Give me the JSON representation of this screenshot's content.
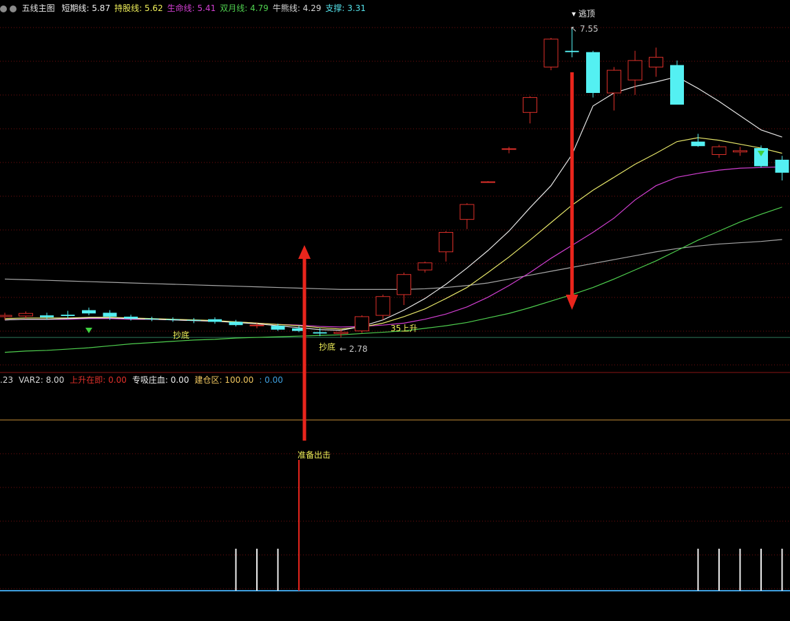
{
  "colors": {
    "background": "#000000",
    "bull": "#e0302a",
    "bear": "#54f0f2",
    "white": "#e8e8e8",
    "yellow": "#e8e86a",
    "magenta": "#d23fd2",
    "green": "#4fd14f",
    "grey": "#a8a8a8",
    "grid": "#7a1010",
    "arrow": "#e8251c",
    "orange": "#c89036",
    "blue": "#3fa0e0"
  },
  "top_legend": {
    "title": "五线主图",
    "items": [
      {
        "label": "短期线: ",
        "value": "5.87",
        "color": "#f0f0f0"
      },
      {
        "label": "持股线: ",
        "value": "5.62",
        "color": "#f2f25a"
      },
      {
        "label": "生命线: ",
        "value": "5.41",
        "color": "#d23fd2"
      },
      {
        "label": "双月线: ",
        "value": "4.79",
        "color": "#4fd14f"
      },
      {
        "label": "牛熊线: ",
        "value": "4.29",
        "color": "#d8d8d8"
      },
      {
        "label": "支撑: ",
        "value": "3.31",
        "color": "#54e2ea"
      }
    ]
  },
  "bottom_legend": {
    "items": [
      {
        "text": ".23",
        "color": "#d8d8d8"
      },
      {
        "text": "VAR2: 8.00",
        "color": "#d8d8d8"
      },
      {
        "text": "上升在即: 0.00",
        "color": "#e0302a"
      },
      {
        "text": "专吸庄血: 0.00",
        "color": "#f0f0f0"
      },
      {
        "text": "建仓区: 100.00",
        "color": "#f2c860"
      },
      {
        "text": ": 0.00",
        "color": "#3fa0e0"
      }
    ]
  },
  "annotations": {
    "chaodi1": "抄底",
    "chaodi2": "抄底",
    "low": "2.78",
    "high": "7.55",
    "rise": "35上升",
    "top_signal": "逃顶",
    "prepare": "准备出击"
  },
  "chart_data": {
    "type": "candlestick",
    "candles": [
      {
        "o": 3.1,
        "h": 3.16,
        "l": 3.05,
        "c": 3.12
      },
      {
        "o": 3.11,
        "h": 3.18,
        "l": 3.07,
        "c": 3.15
      },
      {
        "o": 3.12,
        "h": 3.16,
        "l": 3.05,
        "c": 3.09
      },
      {
        "o": 3.13,
        "h": 3.19,
        "l": 3.07,
        "c": 3.11
      },
      {
        "o": 3.2,
        "h": 3.24,
        "l": 3.12,
        "c": 3.15
      },
      {
        "o": 3.16,
        "h": 3.2,
        "l": 3.05,
        "c": 3.1
      },
      {
        "o": 3.1,
        "h": 3.13,
        "l": 3.04,
        "c": 3.07
      },
      {
        "o": 3.07,
        "h": 3.1,
        "l": 3.03,
        "c": 3.06
      },
      {
        "o": 3.06,
        "h": 3.09,
        "l": 3.02,
        "c": 3.05
      },
      {
        "o": 3.05,
        "h": 3.08,
        "l": 3.0,
        "c": 3.04
      },
      {
        "o": 3.06,
        "h": 3.09,
        "l": 2.99,
        "c": 3.02
      },
      {
        "o": 3.02,
        "h": 3.05,
        "l": 2.95,
        "c": 2.97
      },
      {
        "o": 2.96,
        "h": 3.0,
        "l": 2.92,
        "c": 2.97
      },
      {
        "o": 2.96,
        "h": 2.99,
        "l": 2.88,
        "c": 2.9
      },
      {
        "o": 2.92,
        "h": 2.96,
        "l": 2.86,
        "c": 2.88
      },
      {
        "o": 2.86,
        "h": 2.92,
        "l": 2.8,
        "c": 2.84
      },
      {
        "o": 2.84,
        "h": 2.9,
        "l": 2.78,
        "c": 2.86
      },
      {
        "o": 2.88,
        "h": 3.12,
        "l": 2.85,
        "c": 3.1
      },
      {
        "o": 3.12,
        "h": 3.44,
        "l": 3.05,
        "c": 3.41
      },
      {
        "o": 3.44,
        "h": 3.78,
        "l": 3.28,
        "c": 3.75
      },
      {
        "o": 3.82,
        "h": 3.95,
        "l": 3.78,
        "c": 3.93
      },
      {
        "o": 4.1,
        "h": 4.42,
        "l": 3.95,
        "c": 4.4
      },
      {
        "o": 4.6,
        "h": 4.85,
        "l": 4.45,
        "c": 4.83
      },
      {
        "o": 5.18,
        "h": 5.19,
        "l": 5.17,
        "c": 5.18
      },
      {
        "o": 5.69,
        "h": 5.72,
        "l": 5.62,
        "c": 5.69
      },
      {
        "o": 6.25,
        "h": 6.5,
        "l": 6.08,
        "c": 6.48
      },
      {
        "o": 6.95,
        "h": 7.4,
        "l": 6.9,
        "c": 7.38
      },
      {
        "o": 7.2,
        "h": 7.55,
        "l": 7.1,
        "c": 7.18
      },
      {
        "o": 7.18,
        "h": 7.2,
        "l": 6.48,
        "c": 6.55
      },
      {
        "o": 6.55,
        "h": 6.95,
        "l": 6.28,
        "c": 6.9
      },
      {
        "o": 6.75,
        "h": 7.2,
        "l": 6.52,
        "c": 7.05
      },
      {
        "o": 6.95,
        "h": 7.25,
        "l": 6.8,
        "c": 7.1
      },
      {
        "o": 6.98,
        "h": 7.05,
        "l": 6.45,
        "c": 6.37
      },
      {
        "o": 5.8,
        "h": 5.92,
        "l": 5.72,
        "c": 5.73
      },
      {
        "o": 5.6,
        "h": 5.75,
        "l": 5.55,
        "c": 5.72
      },
      {
        "o": 5.64,
        "h": 5.72,
        "l": 5.58,
        "c": 5.66
      },
      {
        "o": 5.7,
        "h": 5.74,
        "l": 5.4,
        "c": 5.42
      },
      {
        "o": 5.52,
        "h": 5.58,
        "l": 5.2,
        "c": 5.32
      }
    ],
    "ma_short": [
      3.05,
      3.06,
      3.06,
      3.07,
      3.08,
      3.08,
      3.07,
      3.06,
      3.05,
      3.04,
      3.03,
      3.01,
      2.99,
      2.96,
      2.93,
      2.9,
      2.89,
      2.95,
      3.05,
      3.2,
      3.38,
      3.6,
      3.85,
      4.12,
      4.42,
      4.78,
      5.12,
      5.6,
      6.35,
      6.55,
      6.65,
      6.72,
      6.8,
      6.62,
      6.42,
      6.2,
      5.98,
      5.87
    ],
    "ma_hold": [
      3.07,
      3.08,
      3.08,
      3.08,
      3.09,
      3.09,
      3.08,
      3.07,
      3.06,
      3.05,
      3.04,
      3.02,
      3.0,
      2.98,
      2.96,
      2.93,
      2.91,
      2.94,
      3.0,
      3.1,
      3.22,
      3.38,
      3.55,
      3.78,
      4.02,
      4.28,
      4.55,
      4.82,
      5.05,
      5.25,
      5.45,
      5.62,
      5.8,
      5.86,
      5.82,
      5.76,
      5.7,
      5.62
    ],
    "ma_life": [
      3.05,
      3.06,
      3.06,
      3.06,
      3.07,
      3.07,
      3.06,
      3.06,
      3.05,
      3.04,
      3.03,
      3.02,
      3.0,
      2.98,
      2.97,
      2.95,
      2.94,
      2.95,
      2.97,
      3.0,
      3.06,
      3.14,
      3.25,
      3.4,
      3.58,
      3.78,
      4.0,
      4.2,
      4.4,
      4.62,
      4.9,
      5.12,
      5.25,
      5.31,
      5.36,
      5.39,
      5.4,
      5.41
    ],
    "ma_month": [
      2.55,
      2.57,
      2.58,
      2.6,
      2.62,
      2.65,
      2.68,
      2.7,
      2.72,
      2.74,
      2.75,
      2.77,
      2.78,
      2.79,
      2.8,
      2.81,
      2.82,
      2.84,
      2.86,
      2.88,
      2.92,
      2.96,
      3.01,
      3.08,
      3.15,
      3.24,
      3.34,
      3.44,
      3.55,
      3.68,
      3.82,
      3.96,
      4.12,
      4.28,
      4.42,
      4.56,
      4.68,
      4.79
    ],
    "ma_bull": [
      3.68,
      3.67,
      3.66,
      3.65,
      3.64,
      3.63,
      3.62,
      3.61,
      3.6,
      3.59,
      3.58,
      3.57,
      3.56,
      3.55,
      3.54,
      3.53,
      3.52,
      3.52,
      3.52,
      3.52,
      3.53,
      3.55,
      3.58,
      3.62,
      3.68,
      3.74,
      3.8,
      3.86,
      3.92,
      3.98,
      4.04,
      4.1,
      4.15,
      4.19,
      4.22,
      4.24,
      4.26,
      4.29
    ],
    "support": 2.78,
    "ylim": [
      2.25,
      7.75
    ],
    "lower_panel": {
      "signal_bars": [
        11,
        12,
        13,
        33,
        34,
        35,
        36,
        37
      ],
      "prepare_index": 14
    }
  }
}
